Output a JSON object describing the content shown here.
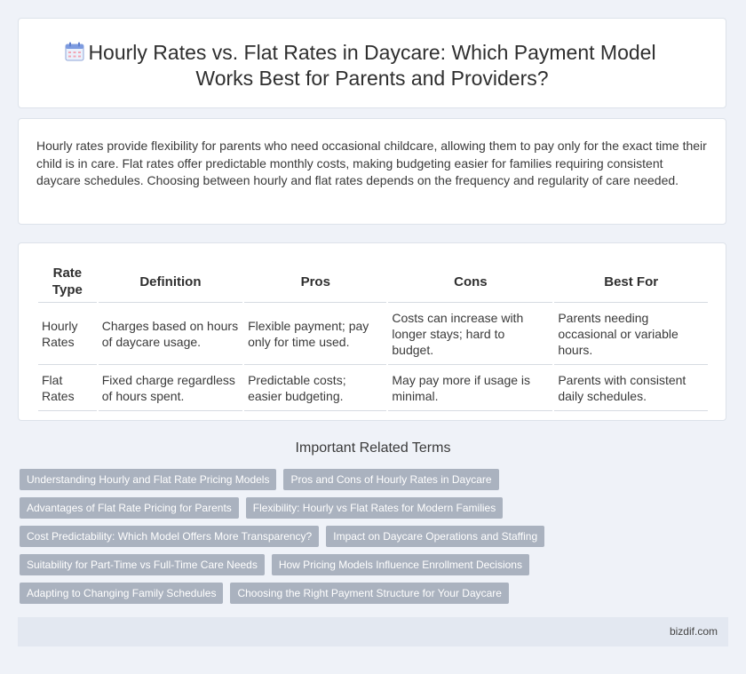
{
  "header": {
    "title_line1": "Hourly Rates vs. Flat Rates in Daycare: Which Payment Model",
    "title_line2": "Works Best for Parents and Providers?",
    "icon": "calendar-icon"
  },
  "intro": {
    "text": "Hourly rates provide flexibility for parents who need occasional childcare, allowing them to pay only for the exact time their child is in care. Flat rates offer predictable monthly costs, making budgeting easier for families requiring consistent daycare schedules. Choosing between hourly and flat rates depends on the frequency and regularity of care needed."
  },
  "table": {
    "headers": [
      "Rate Type",
      "Definition",
      "Pros",
      "Cons",
      "Best For"
    ],
    "rows": [
      [
        "Hourly Rates",
        "Charges based on hours of daycare usage.",
        "Flexible payment; pay only for time used.",
        "Costs can increase with longer stays; hard to budget.",
        "Parents needing occasional or variable hours."
      ],
      [
        "Flat Rates",
        "Fixed charge regardless of hours spent.",
        "Predictable costs; easier budgeting.",
        "May pay more if usage is minimal.",
        "Parents with consistent daily schedules."
      ]
    ]
  },
  "terms": {
    "heading": "Important Related Terms",
    "items": [
      "Understanding Hourly and Flat Rate Pricing Models",
      "Pros and Cons of Hourly Rates in Daycare",
      "Advantages of Flat Rate Pricing for Parents",
      "Flexibility: Hourly vs Flat Rates for Modern Families",
      "Cost Predictability: Which Model Offers More Transparency?",
      "Impact on Daycare Operations and Staffing",
      "Suitability for Part-Time vs Full-Time Care Needs",
      "How Pricing Models Influence Enrollment Decisions",
      "Adapting to Changing Family Schedules",
      "Choosing the Right Payment Structure for Your Daycare"
    ]
  },
  "footer": {
    "site": "bizdif.com"
  },
  "colors": {
    "background": "#eff2f8",
    "tag": "#aab2bf",
    "footer": "#e3e8f1"
  }
}
